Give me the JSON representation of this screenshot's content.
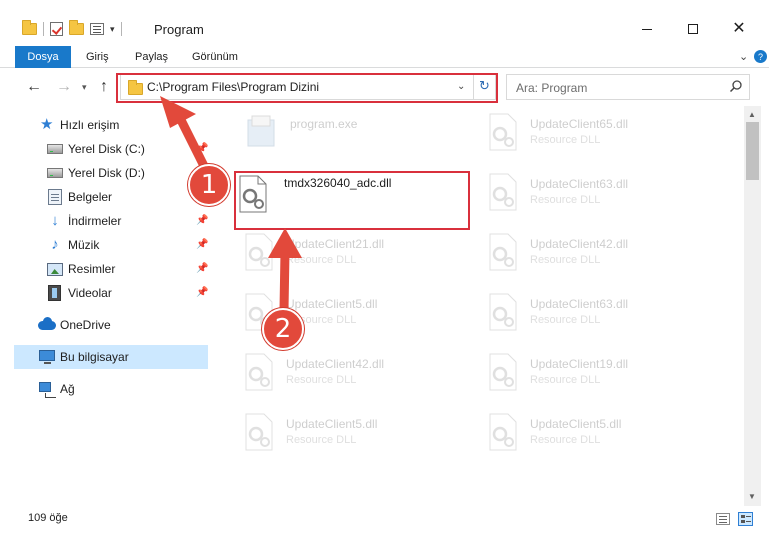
{
  "window": {
    "title": "Program",
    "minimize_icon": "minimize-icon",
    "maximize_icon": "maximize-icon",
    "close_icon": "close-icon"
  },
  "ribbon": {
    "tabs": [
      "Dosya",
      "Giriş",
      "Paylaş",
      "Görünüm"
    ],
    "active_tab_color": "#1979ca",
    "help_glyph": "?"
  },
  "navigation": {
    "address": "C:\\Program Files\\Program Dizini",
    "search_placeholder": "Ara: Program"
  },
  "sidebar": {
    "items": [
      {
        "label": "Hızlı erişim",
        "icon": "star-icon"
      },
      {
        "label": "Yerel Disk (C:)",
        "icon": "drive-icon",
        "pinned": true
      },
      {
        "label": "Yerel Disk (D:)",
        "icon": "drive-icon",
        "pinned": true
      },
      {
        "label": "Belgeler",
        "icon": "documents-icon",
        "pinned": true
      },
      {
        "label": "İndirmeler",
        "icon": "downloads-icon",
        "pinned": true
      },
      {
        "label": "Müzik",
        "icon": "music-icon",
        "pinned": true
      },
      {
        "label": "Resimler",
        "icon": "pictures-icon",
        "pinned": true
      },
      {
        "label": "Videolar",
        "icon": "videos-icon",
        "pinned": true
      },
      {
        "label": "OneDrive",
        "icon": "onedrive-icon"
      },
      {
        "label": "Bu bilgisayar",
        "icon": "this-pc-icon",
        "selected": true
      },
      {
        "label": "Ağ",
        "icon": "network-icon"
      }
    ]
  },
  "files": [
    {
      "name": "program.exe",
      "type": "",
      "faded": true
    },
    {
      "name": "UpdateClient65.dll",
      "type": "Resource DLL",
      "faded": true
    },
    {
      "name": "tmdx326040_adc.dll",
      "type": "",
      "faded": false
    },
    {
      "name": "UpdateClient63.dll",
      "type": "Resource DLL",
      "faded": true
    },
    {
      "name": "UpdateClient21.dll",
      "type": "Resource DLL",
      "faded": true
    },
    {
      "name": "UpdateClient42.dll",
      "type": "Resource DLL",
      "faded": true
    },
    {
      "name": "UpdateClient5.dll",
      "type": "Resource DLL",
      "faded": true
    },
    {
      "name": "UpdateClient63.dll",
      "type": "Resource DLL",
      "faded": true
    },
    {
      "name": "UpdateClient42.dll",
      "type": "Resource DLL",
      "faded": true
    },
    {
      "name": "UpdateClient19.dll",
      "type": "Resource DLL",
      "faded": true
    },
    {
      "name": "UpdateClient5.dll",
      "type": "Resource DLL",
      "faded": true
    },
    {
      "name": "UpdateClient5.dll",
      "type": "Resource DLL",
      "faded": true
    }
  ],
  "status": {
    "item_count": "109 öğe"
  },
  "annotations": {
    "step1": "1",
    "step2": "2",
    "highlight_color": "#d9303c",
    "badge_color": "#e2493b"
  }
}
